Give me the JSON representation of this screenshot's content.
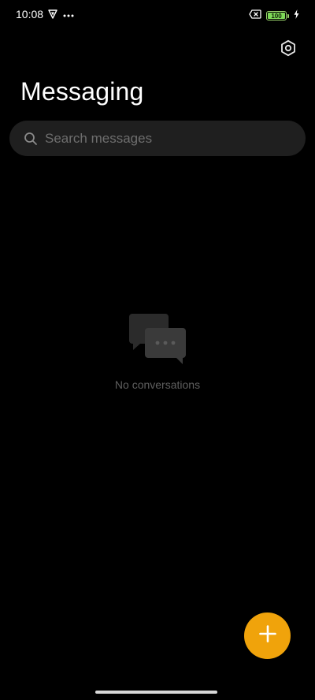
{
  "status_bar": {
    "time": "10:08",
    "battery_level": "100",
    "battery_percent": 100,
    "charging": true,
    "icons": [
      "vpn-shield-icon",
      "more-notifications-icon",
      "sim-error-icon",
      "battery-icon",
      "charging-bolt-icon"
    ]
  },
  "header": {
    "title": "Messaging",
    "settings_icon": "gear-icon"
  },
  "search": {
    "placeholder": "Search messages",
    "value": "",
    "icon": "search-icon"
  },
  "empty_state": {
    "icon": "chat-bubbles-icon",
    "message": "No conversations"
  },
  "fab": {
    "icon": "plus-icon",
    "color": "#f0a30b"
  },
  "theme": {
    "background": "#000000",
    "surface": "#1f1f1f",
    "accent": "#f0a30b",
    "battery_color": "#7ed957"
  }
}
